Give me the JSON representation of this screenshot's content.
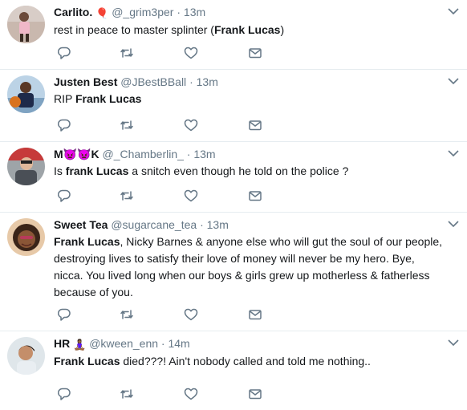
{
  "tweets": [
    {
      "name": "Carlito.",
      "name_emoji": "🎈",
      "handle": "@_grim3per",
      "dot": "·",
      "time": "13m",
      "text_before": "rest in peace to master splinter (",
      "text_bold": "Frank Lucas",
      "text_after": ")"
    },
    {
      "name": "Justen Best",
      "name_emoji": "",
      "handle": "@JBestBBall",
      "dot": "·",
      "time": "13m",
      "text_before": "RIP ",
      "text_bold": "Frank Lucas",
      "text_after": ""
    },
    {
      "name": "M👿👿K",
      "name_emoji": "",
      "handle": "@_Chamberlin_",
      "dot": "·",
      "time": "13m",
      "text_before": "Is ",
      "text_bold": "frank Lucas",
      "text_after": " a snitch even though he told on the police ?"
    },
    {
      "name": "Sweet Tea",
      "name_emoji": "",
      "handle": "@sugarcane_tea",
      "dot": "·",
      "time": "13m",
      "text_before": "",
      "text_bold": "Frank Lucas",
      "text_after": ", Nicky Barnes & anyone else who will gut the soul of our people, destroying lives to satisfy their love of money will never be my hero. Bye, nicca. You lived long when our boys & girls grew up motherless & fatherless because of you."
    },
    {
      "name": "HR",
      "name_emoji": "🧘🏾‍♀️",
      "handle": "@kween_enn",
      "dot": "·",
      "time": "14m",
      "text_before": "",
      "text_bold": "Frank Lucas",
      "text_after": " died???! Ain't nobody called and told me nothing.."
    }
  ],
  "icons": {
    "reply": "reply-icon",
    "retweet": "retweet-icon",
    "like": "like-icon",
    "dm": "direct-message-icon",
    "caret": "chevron-down-icon"
  },
  "colors": {
    "text": "#14171a",
    "secondary": "#657786",
    "divider": "#e6ecf0"
  }
}
